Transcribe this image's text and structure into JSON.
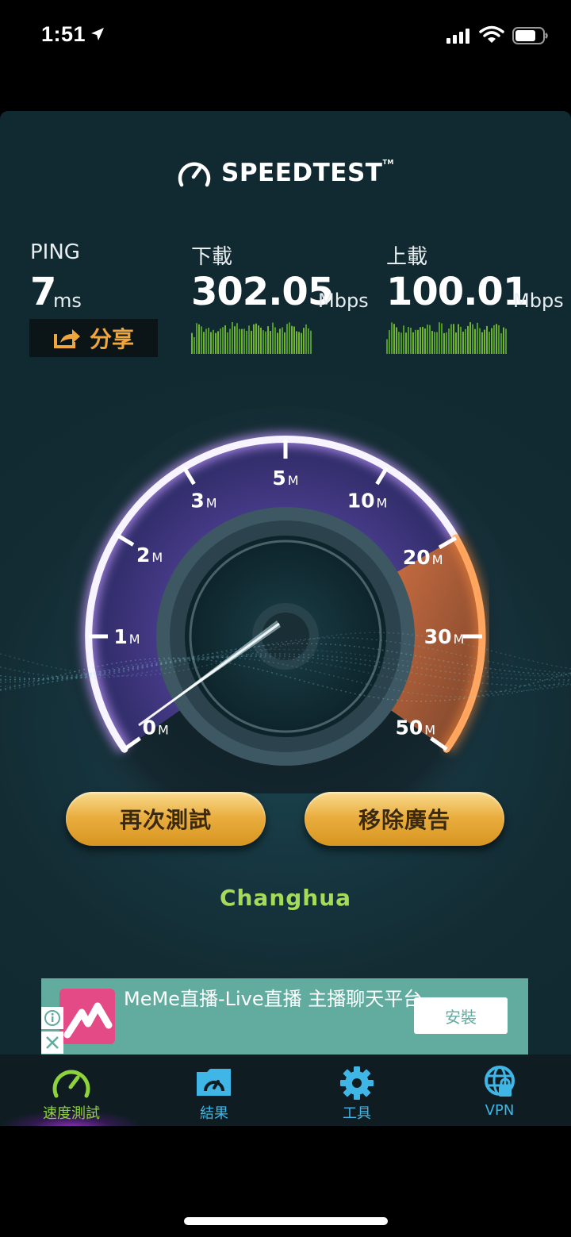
{
  "status_bar": {
    "time": "1:51"
  },
  "app": {
    "brand": "SPEEDTEST",
    "trademark": "TM",
    "ping": {
      "label": "PING",
      "value": "7",
      "unit": "ms"
    },
    "download": {
      "label": "下載",
      "value": "302.05",
      "unit": "Mbps"
    },
    "upload": {
      "label": "上載",
      "value": "100.01",
      "unit": "Mbps"
    },
    "share_label": "分享",
    "gauge": {
      "ticks": [
        {
          "num": "0",
          "unit": "M"
        },
        {
          "num": "1",
          "unit": "M"
        },
        {
          "num": "2",
          "unit": "M"
        },
        {
          "num": "3",
          "unit": "M"
        },
        {
          "num": "5",
          "unit": "M"
        },
        {
          "num": "10",
          "unit": "M"
        },
        {
          "num": "20",
          "unit": "M"
        },
        {
          "num": "30",
          "unit": "M"
        },
        {
          "num": "50",
          "unit": "M"
        }
      ]
    },
    "retest_label": "再次測試",
    "remove_ads_label": "移除廣告",
    "server_location": "Changhua"
  },
  "ad": {
    "title": "MeMe直播-Live直播 主播聊天平台",
    "install_label": "安裝"
  },
  "tabs": [
    {
      "label": "速度測試",
      "active": true
    },
    {
      "label": "結果",
      "active": false
    },
    {
      "label": "工具",
      "active": false
    },
    {
      "label": "VPN",
      "active": false
    }
  ],
  "colors": {
    "accent_green": "#a4dc5a",
    "button_gold": "#e9ad3e",
    "tab_blue": "#3fb6e6",
    "share_orange": "#f0a63a"
  }
}
